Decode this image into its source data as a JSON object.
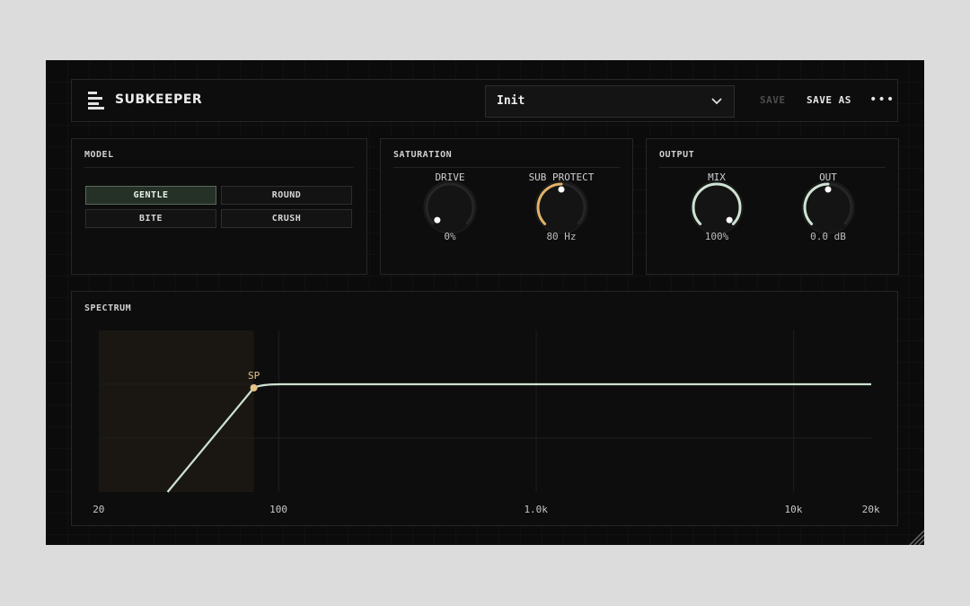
{
  "app": {
    "name": "SUBKEEPER"
  },
  "header": {
    "preset_name": "Init",
    "save_label": "SAVE",
    "save_as_label": "SAVE AS",
    "more_label": "•••"
  },
  "model": {
    "title": "MODEL",
    "options": [
      "GENTLE",
      "ROUND",
      "BITE",
      "CRUSH"
    ],
    "selected": "GENTLE"
  },
  "saturation": {
    "title": "SATURATION",
    "drive": {
      "label": "DRIVE",
      "value": "0%",
      "level": 0.0
    },
    "sub_protect": {
      "label": "SUB PROTECT",
      "value": "80 Hz",
      "level": 0.5
    }
  },
  "output": {
    "title": "OUTPUT",
    "mix": {
      "label": "MIX",
      "value": "100%",
      "level": 1.0
    },
    "out": {
      "label": "OUT",
      "value": "0.0 dB",
      "level": 0.5
    }
  },
  "spectrum": {
    "title": "SPECTRUM",
    "marker_label": "SP",
    "marker_freq": 80,
    "freq_labels": [
      {
        "freq": 20,
        "text": "20"
      },
      {
        "freq": 100,
        "text": "100"
      },
      {
        "freq": 1000,
        "text": "1.0k"
      },
      {
        "freq": 10000,
        "text": "10k"
      },
      {
        "freq": 20000,
        "text": "20k"
      }
    ]
  },
  "colors": {
    "accent_curve": "#cfe3d2",
    "accent_knob": "#cfe3d2",
    "accent_sub": "#e0b267",
    "marker": "#e7c38a"
  }
}
